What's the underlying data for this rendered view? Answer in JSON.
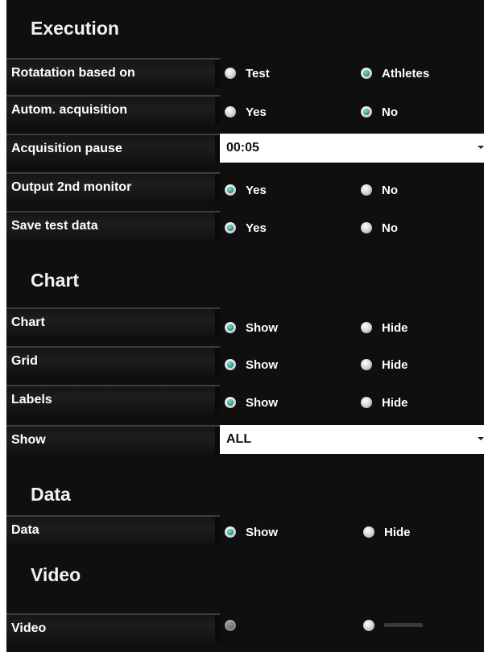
{
  "sections": {
    "execution": "Execution",
    "chart": "Chart",
    "data": "Data",
    "video": "Video"
  },
  "rows": {
    "rotation": {
      "label": "Rotatation based on",
      "options": [
        "Test",
        "Athletes"
      ],
      "selected": "Athletes"
    },
    "autom_acquisition": {
      "label": "Autom. acquisition",
      "options": [
        "Yes",
        "No"
      ],
      "selected": "No"
    },
    "acquisition_pause": {
      "label": "Acquisition pause",
      "value": "00:05"
    },
    "output_2nd_monitor": {
      "label": "Output 2nd monitor",
      "options": [
        "Yes",
        "No"
      ],
      "selected": "Yes"
    },
    "save_test_data": {
      "label": "Save test data",
      "options": [
        "Yes",
        "No"
      ],
      "selected": "Yes"
    },
    "chart": {
      "label": "Chart",
      "options": [
        "Show",
        "Hide"
      ],
      "selected": "Show"
    },
    "grid": {
      "label": "Grid",
      "options": [
        "Show",
        "Hide"
      ],
      "selected": "Show"
    },
    "labels": {
      "label": "Labels",
      "options": [
        "Show",
        "Hide"
      ],
      "selected": "Show"
    },
    "show": {
      "label": "Show",
      "value": "ALL"
    },
    "data": {
      "label": "Data",
      "options": [
        "Show",
        "Hide"
      ],
      "selected": "Show"
    },
    "video": {
      "label": "Video",
      "selected_index": 0
    }
  },
  "colors": {
    "panel_background": "#0f0f0f",
    "radio_selected": "#2f9f90",
    "text": "#ffffff",
    "dropdown_background": "#ffffff"
  },
  "icons": {
    "dropdown": "chevron-down-icon",
    "radio": "radio-button-icon"
  }
}
